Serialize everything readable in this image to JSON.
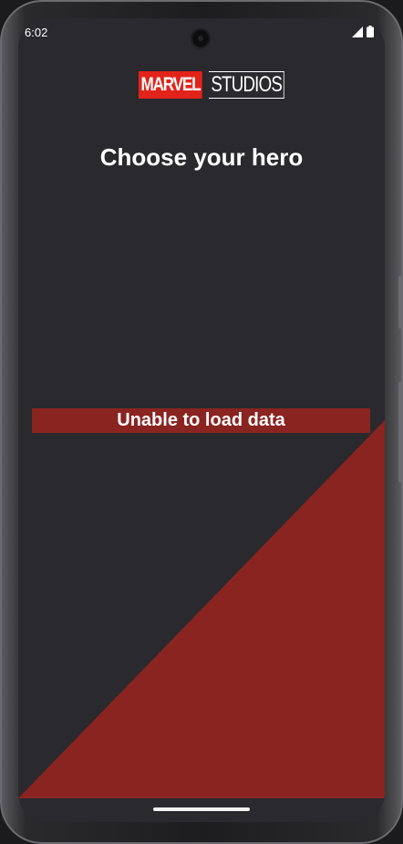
{
  "status_bar": {
    "time": "6:02",
    "icons": [
      "signal-icon",
      "battery-icon"
    ]
  },
  "brand": {
    "logo_part1": "MARVEL",
    "logo_part2": "STUDIOS",
    "accent_color": "#e2231a"
  },
  "main": {
    "title": "Choose your hero",
    "error_message": "Unable to load data",
    "background_color": "#2a292e",
    "triangle_color": "#8a2420"
  },
  "nav": {
    "gesture_handle": "home-gesture-handle"
  }
}
